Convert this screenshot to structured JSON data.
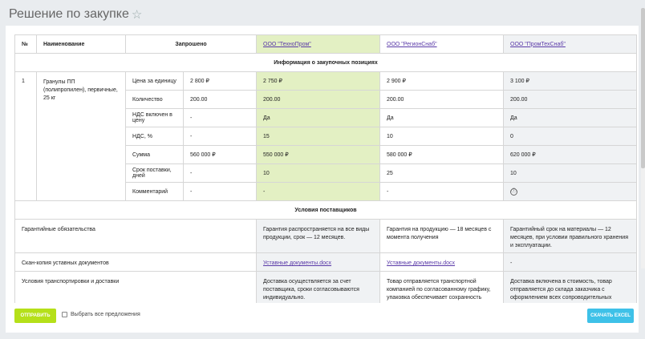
{
  "page": {
    "title": "Решение по закупке"
  },
  "table": {
    "headers": {
      "no": "№",
      "name": "Наименование",
      "requested": "Запрошено"
    },
    "suppliers": [
      "ООО \"ТехноПром\"",
      "ООО \"РегионСнаб\"",
      "ООО \"ПромТехСнаб\""
    ],
    "section_positions": "Информация о закупочных позициях",
    "item": {
      "no": "1",
      "name": "Гранулы ПП (полипропилен), первичные, 25 кг",
      "rows": [
        {
          "label": "Цена за единицу",
          "requested": "2 800 ₽",
          "s1": "2 750 ₽",
          "s2": "2 900 ₽",
          "s3": "3 100 ₽"
        },
        {
          "label": "Количество",
          "requested": "200.00",
          "s1": "200.00",
          "s2": "200.00",
          "s3": "200.00"
        },
        {
          "label": "НДС включен в цену",
          "requested": "-",
          "s1": "Да",
          "s2": "Да",
          "s3": "Да"
        },
        {
          "label": "НДС, %",
          "requested": "-",
          "s1": "15",
          "s2": "10",
          "s3": "0"
        },
        {
          "label": "Сумма",
          "requested": "560 000 ₽",
          "s1": "550 000 ₽",
          "s2": "580 000 ₽",
          "s3": "620 000 ₽"
        },
        {
          "label": "Срок поставки, дней",
          "requested": "-",
          "s1": "10",
          "s2": "25",
          "s3": "10"
        },
        {
          "label": "Комментарий",
          "requested": "-",
          "s1": "-",
          "s2": "-",
          "s3": "ⓘ"
        }
      ]
    },
    "section_conditions": "Условия поставщиков",
    "conditions": [
      {
        "label": "Гарантийные обязательства",
        "s1": "Гарантия распространяется на все виды продукции, срок — 12 месяцев.",
        "s2": "Гарантия на продукцию — 18 месяцев с момента получения",
        "s3": "Гарантийный срок на материалы — 12 месяцев, при условии правильного хранения и эксплуатации."
      },
      {
        "label": "Скан-копия уставных документов",
        "s1": "Уставные документы.docx",
        "s2": "Уставные документы.docx",
        "s3": "-"
      },
      {
        "label": "Условия транспортировки и доставки",
        "s1": "Доставка осуществляется за счет поставщика, сроки согласовываются индивидуально.",
        "s2": "Товар отправляется транспортной компанией по согласованному графику, упаковка обеспечивает сохранность",
        "s3": "Доставка включена в стоимость, товар отправляется до склада заказчика с оформлением всех сопроводительных"
      }
    ]
  },
  "footer": {
    "submit_label": "ОТПРАВИТЬ",
    "select_all_label": "Выбрать все предложения",
    "excel_label": "СКАЧАТЬ EXCEL"
  },
  "colors": {
    "highlight": "#e3f0c3",
    "submit": "#b5e019",
    "excel": "#3ec1e8"
  }
}
